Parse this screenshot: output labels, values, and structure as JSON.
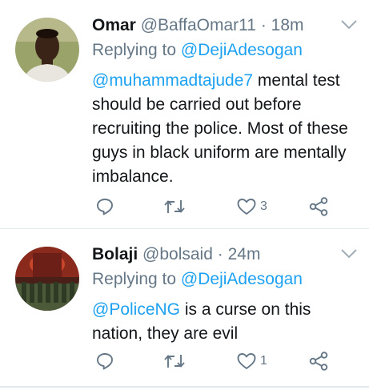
{
  "tweets": [
    {
      "name": "Omar",
      "handle": "@BaffaOmar11",
      "separator": "·",
      "time": "18m",
      "replying_prefix": "Replying to",
      "replying_to": "@DejiAdesogan",
      "mention": "@muhammadtajude7",
      "text_after_mention": " mental test should be carried out before recruiting the police.  Most of these guys in black uniform are mentally imbalance.",
      "like_count": "3",
      "icons": {
        "reply": "reply-icon",
        "retweet": "retweet-icon",
        "like": "heart-icon",
        "share": "share-icon",
        "menu": "chevron-down-icon"
      }
    },
    {
      "name": "Bolaji",
      "handle": "@bolsaid",
      "separator": "·",
      "time": "24m",
      "replying_prefix": "Replying to",
      "replying_to": "@DejiAdesogan",
      "mention": "@PoliceNG",
      "text_after_mention": " is a curse on this nation, they are evil",
      "like_count": "1",
      "icons": {
        "reply": "reply-icon",
        "retweet": "retweet-icon",
        "like": "heart-icon",
        "share": "share-icon",
        "menu": "chevron-down-icon"
      }
    }
  ],
  "colors": {
    "accent": "#1da1f2",
    "muted": "#657786",
    "text": "#14171a",
    "divider": "#e1e8ed"
  }
}
